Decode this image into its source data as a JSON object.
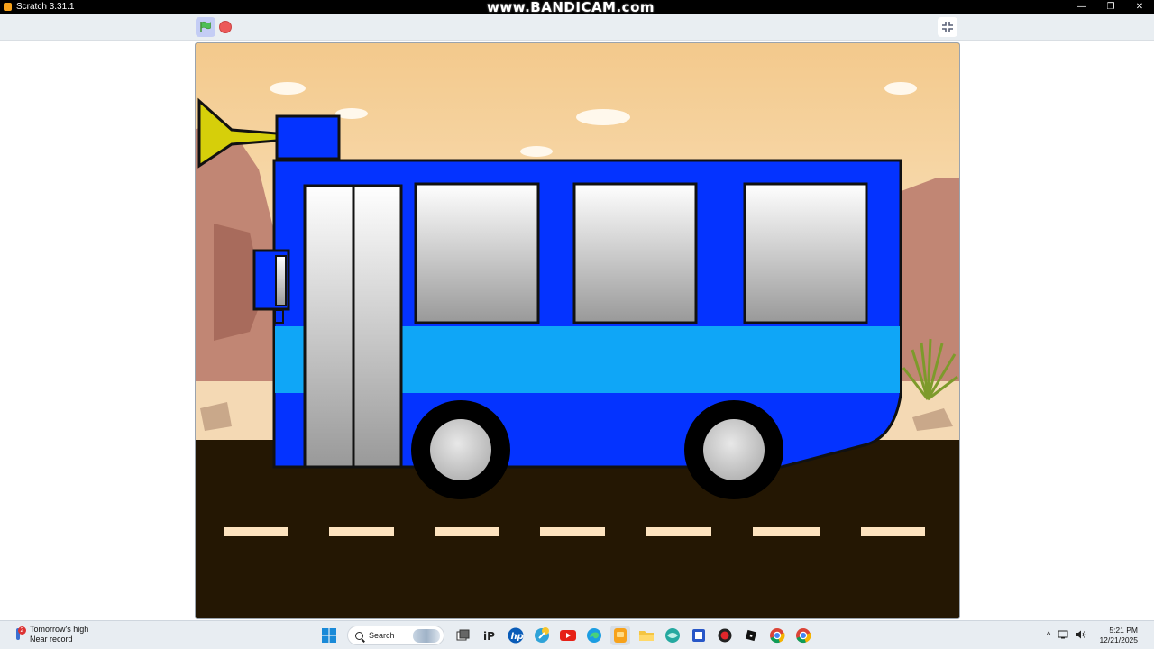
{
  "window": {
    "title": "Scratch 3.31.1",
    "watermark": "www.BANDICAM.com",
    "minimize_glyph": "—",
    "maximize_glyph": "❐",
    "close_glyph": "✕"
  },
  "player": {
    "green_flag_icon": "green-flag-icon",
    "stop_icon": "stop-sign-icon",
    "fullscreen_icon": "exit-fullscreen-icon"
  },
  "stage": {
    "scene": "desert-road",
    "sprites": [
      "bus",
      "horn"
    ],
    "colors": {
      "sky_top": "#f3c98c",
      "sky_bottom": "#fdf0d8",
      "road": "#241703",
      "road_marking": "#fde3bf",
      "bus_body": "#0433ff",
      "bus_stripe": "#0fa6f7",
      "horn": "#d6cf0a",
      "rock": "#c18674"
    }
  },
  "taskbar": {
    "weather": {
      "badge": "2",
      "line1": "Tomorrow's high",
      "line2": "Near record"
    },
    "search_placeholder": "Search",
    "pinned_icons": [
      "windows-start-icon",
      "search-icon",
      "task-view-icon",
      "ipcop-icon",
      "hp-icon",
      "notes-icon",
      "youtube-icon",
      "edge-icon",
      "scratch-icon",
      "file-explorer-icon",
      "browser-icon",
      "screenshot-icon",
      "bandicam-record-icon",
      "roblox-icon",
      "chrome-icon",
      "chrome-icon"
    ],
    "tray": {
      "chevron": "^",
      "time": "5:21 PM",
      "date": "12/21/2025"
    }
  }
}
